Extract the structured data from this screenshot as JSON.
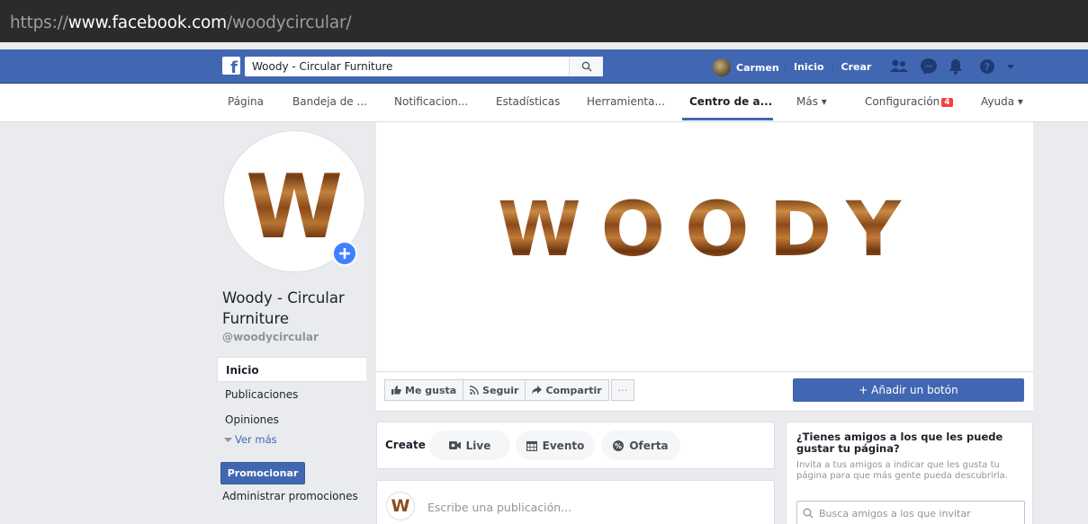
{
  "browser": {
    "url_scheme": "https://",
    "url_host": "www.facebook.com",
    "url_path": "/woodycircular/"
  },
  "topbar": {
    "search_value": "Woody - Circular Furniture",
    "user_name": "Carmen",
    "links": [
      "Inicio",
      "Crear"
    ]
  },
  "tabs": {
    "items": [
      "Página",
      "Bandeja de ...",
      "Notificacion...",
      "Estadísticas",
      "Herramienta...",
      "Centro de a...",
      "Más ▾",
      "Configuración",
      "Ayuda ▾"
    ],
    "settings_badge": "4",
    "active_index": 5
  },
  "page": {
    "name": "Woody - Circular Furniture",
    "handle": "@woodycircular",
    "cover_text": "WOODY",
    "profile_letter": "W"
  },
  "sidebar": {
    "items": [
      "Inicio",
      "Publicaciones",
      "Opiniones"
    ],
    "see_more": "Ver más",
    "promote": "Promocionar",
    "manage_promotions": "Administrar promociones"
  },
  "actions": {
    "like": "Me gusta",
    "follow": "Seguir",
    "share": "Compartir",
    "more": "···",
    "add_button": "+ Añadir un botón"
  },
  "composer": {
    "create_label": "Create",
    "live": "Live",
    "event": "Evento",
    "offer": "Oferta",
    "placeholder": "Escribe una publicación..."
  },
  "invite": {
    "title": "¿Tienes amigos a los que les puede gustar tu página?",
    "text": "Invita a tus amigos a indicar que les gusta tu página para que más gente pueda descubrirla.",
    "search_placeholder": "Busca amigos a los que invitar"
  },
  "colors": {
    "facebook_blue": "#4267b2",
    "wood_light": "#c07a36",
    "wood_dark": "#6b3a12"
  }
}
